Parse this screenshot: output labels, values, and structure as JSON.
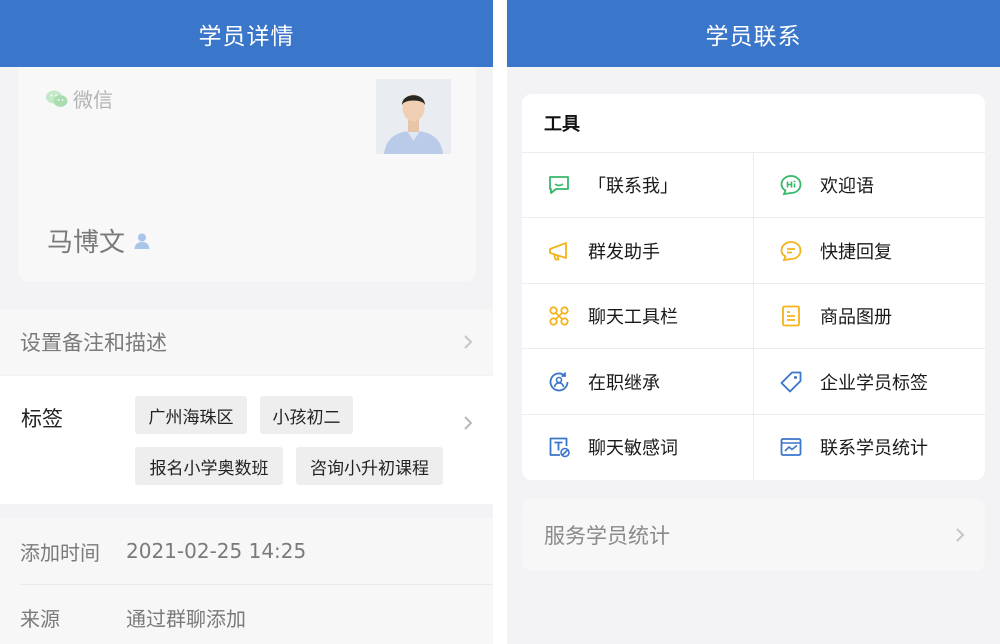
{
  "left": {
    "header_title": "学员详情",
    "profile": {
      "channel": "微信",
      "name": "马博文"
    },
    "remark_label": "设置备注和描述",
    "tags": {
      "label": "标签",
      "items": [
        "广州海珠区",
        "小孩初二",
        "报名小学奥数班",
        "咨询小升初课程"
      ]
    },
    "info": [
      {
        "key": "添加时间",
        "value": "2021-02-25 14:25"
      },
      {
        "key": "来源",
        "value": "通过群聊添加"
      }
    ]
  },
  "right": {
    "header_title": "学员联系",
    "tools_title": "工具",
    "tools": [
      {
        "label": "「联系我」",
        "icon": "chat-bubble-icon",
        "color": "#35b86a"
      },
      {
        "label": "欢迎语",
        "icon": "hi-bubble-icon",
        "color": "#35b86a"
      },
      {
        "label": "群发助手",
        "icon": "megaphone-icon",
        "color": "#f5b31b"
      },
      {
        "label": "快捷回复",
        "icon": "quick-reply-icon",
        "color": "#f5b31b"
      },
      {
        "label": "聊天工具栏",
        "icon": "toolbar-icon",
        "color": "#f5b31b"
      },
      {
        "label": "商品图册",
        "icon": "catalog-icon",
        "color": "#f5b31b"
      },
      {
        "label": "在职继承",
        "icon": "inherit-icon",
        "color": "#3a76c9"
      },
      {
        "label": "企业学员标签",
        "icon": "tag-icon",
        "color": "#3a76c9"
      },
      {
        "label": "聊天敏感词",
        "icon": "sensitive-word-icon",
        "color": "#3a76c9"
      },
      {
        "label": "联系学员统计",
        "icon": "statistics-icon",
        "color": "#3a76c9"
      }
    ],
    "service_stats_label": "服务学员统计"
  },
  "colors": {
    "header": "#3a76c9",
    "green": "#35b86a",
    "yellow": "#f5b31b",
    "blue": "#3a76c9"
  }
}
